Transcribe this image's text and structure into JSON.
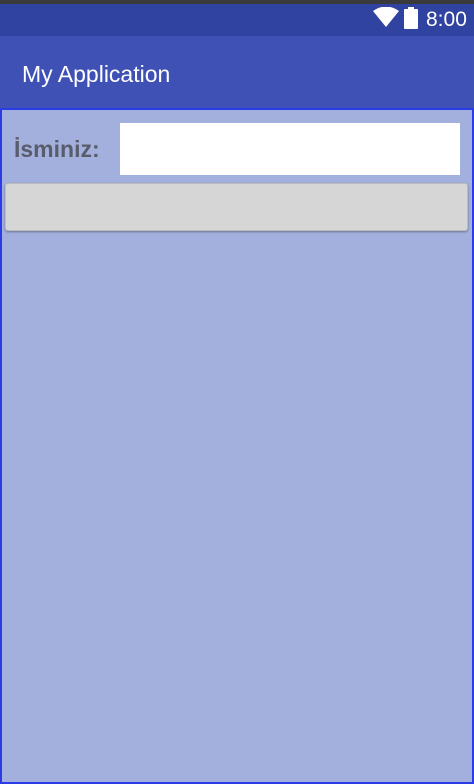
{
  "status_bar": {
    "time": "8:00",
    "icons": [
      "wifi-icon",
      "battery-icon"
    ]
  },
  "app_bar": {
    "title": "My Application"
  },
  "form": {
    "name_label": "İsminiz:",
    "name_value": "",
    "name_placeholder": "",
    "button_label": ""
  },
  "colors": {
    "status_bar": "#3143a0",
    "app_bar": "#3f51b5",
    "background": "#a3afdc",
    "content_border": "#2b3ce6",
    "button": "#d6d6d6",
    "label_text": "#595c6a"
  }
}
